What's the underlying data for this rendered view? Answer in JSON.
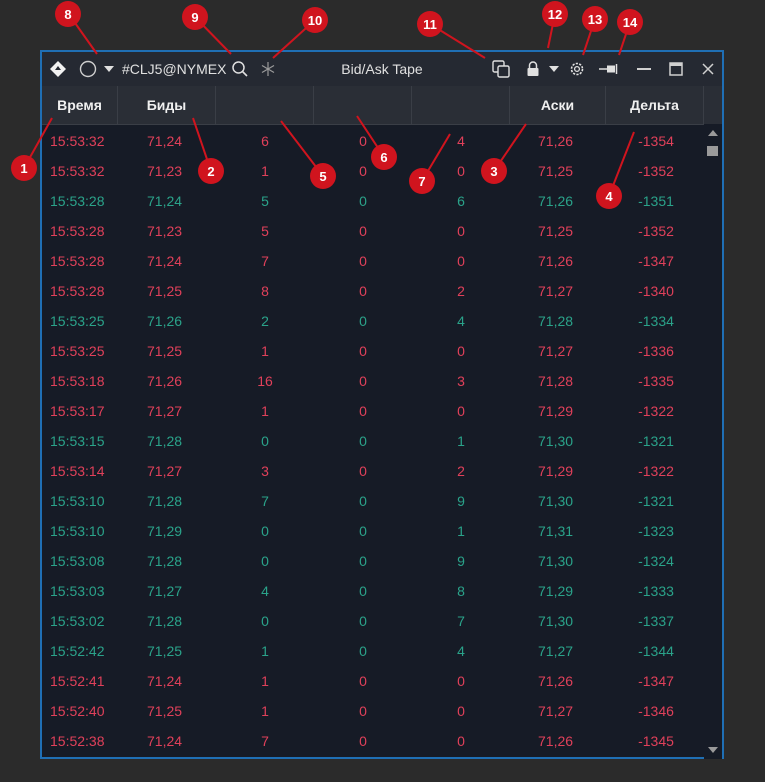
{
  "window": {
    "symbol": "#CLJ5@NYMEX",
    "title": "Bid/Ask Tape"
  },
  "columns": [
    "Время",
    "Биды",
    "",
    "",
    "",
    "Аски",
    "Дельта"
  ],
  "rows": [
    {
      "time": "15:53:32",
      "bid": "71,24",
      "c3": "6",
      "c4": "0",
      "c5": "4",
      "ask": "71,26",
      "delta": "-1354",
      "color": "red"
    },
    {
      "time": "15:53:32",
      "bid": "71,23",
      "c3": "1",
      "c4": "0",
      "c5": "0",
      "ask": "71,25",
      "delta": "-1352",
      "color": "red"
    },
    {
      "time": "15:53:28",
      "bid": "71,24",
      "c3": "5",
      "c4": "0",
      "c5": "6",
      "ask": "71,26",
      "delta": "-1351",
      "color": "green"
    },
    {
      "time": "15:53:28",
      "bid": "71,23",
      "c3": "5",
      "c4": "0",
      "c5": "0",
      "ask": "71,25",
      "delta": "-1352",
      "color": "red"
    },
    {
      "time": "15:53:28",
      "bid": "71,24",
      "c3": "7",
      "c4": "0",
      "c5": "0",
      "ask": "71,26",
      "delta": "-1347",
      "color": "red"
    },
    {
      "time": "15:53:28",
      "bid": "71,25",
      "c3": "8",
      "c4": "0",
      "c5": "2",
      "ask": "71,27",
      "delta": "-1340",
      "color": "red"
    },
    {
      "time": "15:53:25",
      "bid": "71,26",
      "c3": "2",
      "c4": "0",
      "c5": "4",
      "ask": "71,28",
      "delta": "-1334",
      "color": "green"
    },
    {
      "time": "15:53:25",
      "bid": "71,25",
      "c3": "1",
      "c4": "0",
      "c5": "0",
      "ask": "71,27",
      "delta": "-1336",
      "color": "red"
    },
    {
      "time": "15:53:18",
      "bid": "71,26",
      "c3": "16",
      "c4": "0",
      "c5": "3",
      "ask": "71,28",
      "delta": "-1335",
      "color": "red"
    },
    {
      "time": "15:53:17",
      "bid": "71,27",
      "c3": "1",
      "c4": "0",
      "c5": "0",
      "ask": "71,29",
      "delta": "-1322",
      "color": "red"
    },
    {
      "time": "15:53:15",
      "bid": "71,28",
      "c3": "0",
      "c4": "0",
      "c5": "1",
      "ask": "71,30",
      "delta": "-1321",
      "color": "green"
    },
    {
      "time": "15:53:14",
      "bid": "71,27",
      "c3": "3",
      "c4": "0",
      "c5": "2",
      "ask": "71,29",
      "delta": "-1322",
      "color": "red"
    },
    {
      "time": "15:53:10",
      "bid": "71,28",
      "c3": "7",
      "c4": "0",
      "c5": "9",
      "ask": "71,30",
      "delta": "-1321",
      "color": "green"
    },
    {
      "time": "15:53:10",
      "bid": "71,29",
      "c3": "0",
      "c4": "0",
      "c5": "1",
      "ask": "71,31",
      "delta": "-1323",
      "color": "green"
    },
    {
      "time": "15:53:08",
      "bid": "71,28",
      "c3": "0",
      "c4": "0",
      "c5": "9",
      "ask": "71,30",
      "delta": "-1324",
      "color": "green"
    },
    {
      "time": "15:53:03",
      "bid": "71,27",
      "c3": "4",
      "c4": "0",
      "c5": "8",
      "ask": "71,29",
      "delta": "-1333",
      "color": "green"
    },
    {
      "time": "15:53:02",
      "bid": "71,28",
      "c3": "0",
      "c4": "0",
      "c5": "7",
      "ask": "71,30",
      "delta": "-1337",
      "color": "green"
    },
    {
      "time": "15:52:42",
      "bid": "71,25",
      "c3": "1",
      "c4": "0",
      "c5": "4",
      "ask": "71,27",
      "delta": "-1344",
      "color": "green"
    },
    {
      "time": "15:52:41",
      "bid": "71,24",
      "c3": "1",
      "c4": "0",
      "c5": "0",
      "ask": "71,26",
      "delta": "-1347",
      "color": "red"
    },
    {
      "time": "15:52:40",
      "bid": "71,25",
      "c3": "1",
      "c4": "0",
      "c5": "0",
      "ask": "71,27",
      "delta": "-1346",
      "color": "red"
    },
    {
      "time": "15:52:38",
      "bid": "71,24",
      "c3": "7",
      "c4": "0",
      "c5": "0",
      "ask": "71,26",
      "delta": "-1345",
      "color": "red"
    }
  ],
  "colors": {
    "sell": "#e0405a",
    "buy": "#2aa38a",
    "accent": "#1f6fb5",
    "badge": "#d0141e"
  },
  "annotations": [
    "1",
    "2",
    "3",
    "4",
    "5",
    "6",
    "7",
    "8",
    "9",
    "10",
    "11",
    "12",
    "13",
    "14"
  ]
}
